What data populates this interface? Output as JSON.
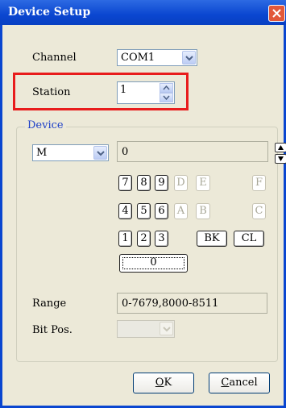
{
  "window": {
    "title": "Device Setup"
  },
  "channel": {
    "label": "Channel",
    "value": "COM1"
  },
  "station": {
    "label": "Station",
    "value": "1"
  },
  "device": {
    "group_label": "Device",
    "type_value": "M",
    "address_value": "0",
    "keys_row1": [
      "7",
      "8",
      "9",
      "D",
      "E",
      "F"
    ],
    "keys_row2": [
      "4",
      "5",
      "6",
      "A",
      "B",
      "C"
    ],
    "keys_row3": [
      "1",
      "2",
      "3",
      "BK",
      "CL"
    ],
    "zero_key": "0",
    "range_label": "Range",
    "range_value": "0-7679,8000-8511",
    "bitpos_label": "Bit Pos.",
    "bitpos_value": ""
  },
  "buttons": {
    "ok_mnemonic": "O",
    "ok_rest": "K",
    "cancel_mnemonic": "C",
    "cancel_rest": "ancel"
  },
  "colors": {
    "titlebar": "#0A46D0",
    "highlight": "#E81C1C",
    "dialog_bg": "#ECE9D8",
    "group_label": "#1E40C8"
  }
}
